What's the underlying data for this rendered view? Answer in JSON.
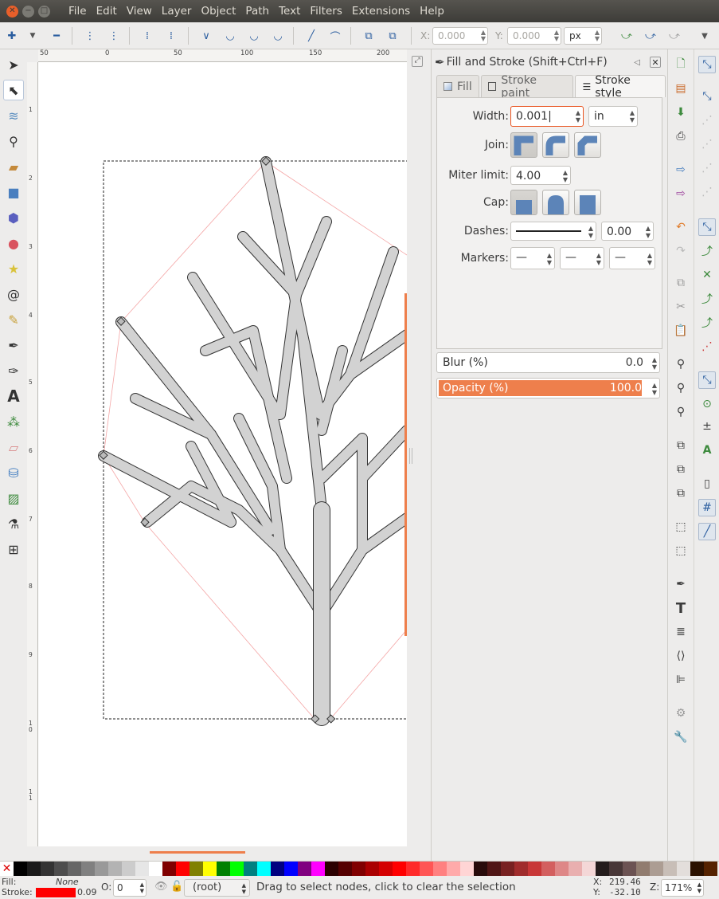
{
  "menu": [
    "File",
    "Edit",
    "View",
    "Layer",
    "Object",
    "Path",
    "Text",
    "Filters",
    "Extensions",
    "Help"
  ],
  "coords": {
    "x_label": "X:",
    "x_value": "0.000",
    "y_label": "Y:",
    "y_value": "0.000",
    "unit": "px"
  },
  "ruler_h": [
    "50",
    "0",
    "50",
    "100",
    "150",
    "200"
  ],
  "ruler_v": [
    "1",
    "2",
    "3",
    "4",
    "5",
    "6",
    "7",
    "8",
    "9",
    "10",
    "11"
  ],
  "dock": {
    "title": "Fill and Stroke (Shift+Ctrl+F)",
    "tabs": [
      "Fill",
      "Stroke paint",
      "Stroke style"
    ],
    "width_label": "Width:",
    "width_value": "0.001",
    "width_unit": "in",
    "join_label": "Join:",
    "miter_label": "Miter limit:",
    "miter_value": "4.00",
    "cap_label": "Cap:",
    "dashes_label": "Dashes:",
    "dashes_value": "0.00",
    "markers_label": "Markers:",
    "blur_label": "Blur (%)",
    "blur_value": "0.0",
    "opacity_label": "Opacity (%)",
    "opacity_value": "100.0",
    "opacity_level": 1.0
  },
  "status": {
    "fill_label": "Fill:",
    "fill_value": "None",
    "stroke_label": "Stroke:",
    "stroke_value": "0.09",
    "opacity_label": "O:",
    "opacity_value": "0",
    "layer": "(root)",
    "message": "Drag to select nodes, click to clear the selection",
    "cx_label": "X:",
    "cx": "219.46",
    "cy_label": "Y:",
    "cy": "-32.10",
    "zoom_label": "Z:",
    "zoom": "171%"
  },
  "colors": {
    "accent": "#e95420",
    "stroke_red": "#ff0000",
    "opacity_bar": "#ee7f4c"
  },
  "palette": [
    "#000000",
    "#1a1a1a",
    "#333333",
    "#4d4d4d",
    "#666666",
    "#808080",
    "#999999",
    "#b3b3b3",
    "#cccccc",
    "#e6e6e6",
    "#ffffff",
    "#800000",
    "#ff0000",
    "#808000",
    "#ffff00",
    "#008000",
    "#00ff00",
    "#008080",
    "#00ffff",
    "#000080",
    "#0000ff",
    "#800080",
    "#ff00ff",
    "#2b0000",
    "#550000",
    "#800000",
    "#aa0000",
    "#d40000",
    "#ff0000",
    "#ff2a2a",
    "#ff5555",
    "#ff8080",
    "#ffaaaa",
    "#ffd5d5",
    "#280b0b",
    "#501616",
    "#782121",
    "#a02c2c",
    "#c83737",
    "#d35f5f",
    "#de8787",
    "#e9afaf",
    "#f4d7d7",
    "#241c1c",
    "#483737",
    "#6c5353",
    "#917c6f",
    "#ac9d93",
    "#c8beb7",
    "#e3dedb",
    "#2b1100",
    "#552200"
  ]
}
